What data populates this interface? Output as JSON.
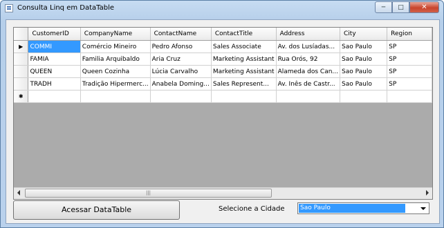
{
  "window": {
    "title": "Consulta Linq em DataTable"
  },
  "grid": {
    "columns": [
      "CustomerID",
      "CompanyName",
      "ContactName",
      "ContactTitle",
      "Address",
      "City",
      "Region"
    ],
    "rows": [
      [
        "COMMI",
        "Comércio Mineiro",
        "Pedro Afonso",
        "Sales Associate",
        "Av. dos Lusíadas...",
        "Sao Paulo",
        "SP"
      ],
      [
        "FAMIA",
        "Familia Arquibaldo",
        "Aria Cruz",
        "Marketing Assistant",
        "Rua Orós, 92",
        "Sao Paulo",
        "SP"
      ],
      [
        "QUEEN",
        "Queen Cozinha",
        "Lúcia Carvalho",
        "Marketing Assistant",
        "Alameda dos Can...",
        "Sao Paulo",
        "SP"
      ],
      [
        "TRADH",
        "Tradição Hipermerc...",
        "Anabela Doming...",
        "Sales Represent...",
        "Av. Inês de Castr...",
        "Sao Paulo",
        "SP"
      ]
    ],
    "current_row_icon": "current-row-arrow-icon",
    "new_row_icon": "new-row-asterisk-icon",
    "selected_cell_color": "#3399ff"
  },
  "controls": {
    "access_button": "Acessar DataTable",
    "city_label": "Selecione a Cidade",
    "city_value": "Sao Paulo"
  }
}
